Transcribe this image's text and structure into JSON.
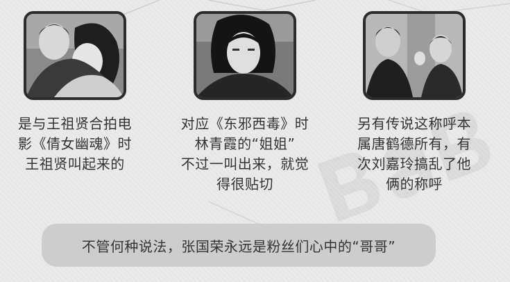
{
  "colors": {
    "background": "#eaeaea",
    "text": "#333333",
    "photo_border": "#2c2c2c",
    "summary_bg": "#c8c8c8"
  },
  "cards": [
    {
      "caption_lines": [
        "是与王祖贤合拍电",
        "影《倩女幽魂》时",
        "王祖贤叫起来的"
      ]
    },
    {
      "caption_lines": [
        "对应《东邪西毒》时",
        "林青霞的“姐姐”",
        "不过一叫出来，就觉",
        "得很贴切"
      ]
    },
    {
      "caption_lines": [
        "另有传说这称呼本",
        "属唐鹤德所有，有",
        "次刘嘉玲搞乱了他",
        "俩的称呼"
      ]
    }
  ],
  "summary": {
    "text": "不管何种说法，张国荣永远是粉丝们心中的“哥哥”"
  }
}
